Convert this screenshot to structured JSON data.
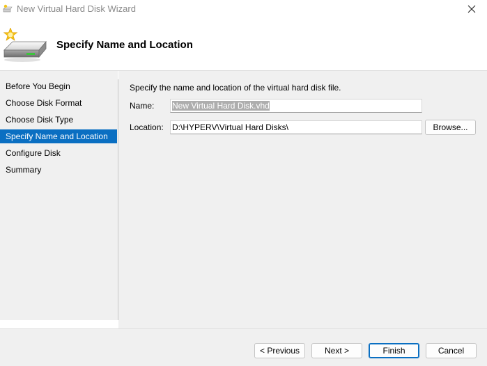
{
  "window": {
    "title": "New Virtual Hard Disk Wizard",
    "close_icon": "close-icon"
  },
  "header": {
    "title": "Specify Name and Location",
    "icon": "hard-disk-wizard-icon"
  },
  "nav": {
    "items": [
      {
        "label": "Before You Begin",
        "active": false
      },
      {
        "label": "Choose Disk Format",
        "active": false
      },
      {
        "label": "Choose Disk Type",
        "active": false
      },
      {
        "label": "Specify Name and Location",
        "active": true
      },
      {
        "label": "Configure Disk",
        "active": false
      },
      {
        "label": "Summary",
        "active": false
      }
    ]
  },
  "main": {
    "instruction": "Specify the name and location of the virtual hard disk file.",
    "name_label": "Name:",
    "name_value": "New Virtual Hard Disk.vhd",
    "location_label": "Location:",
    "location_value": "D:\\HYPERV\\Virtual Hard Disks\\",
    "browse_label": "Browse..."
  },
  "footer": {
    "previous_label": "< Previous",
    "next_label": "Next >",
    "finish_label": "Finish",
    "cancel_label": "Cancel"
  },
  "colors": {
    "accent": "#0a6fc2",
    "panel": "#f0f0f0"
  }
}
